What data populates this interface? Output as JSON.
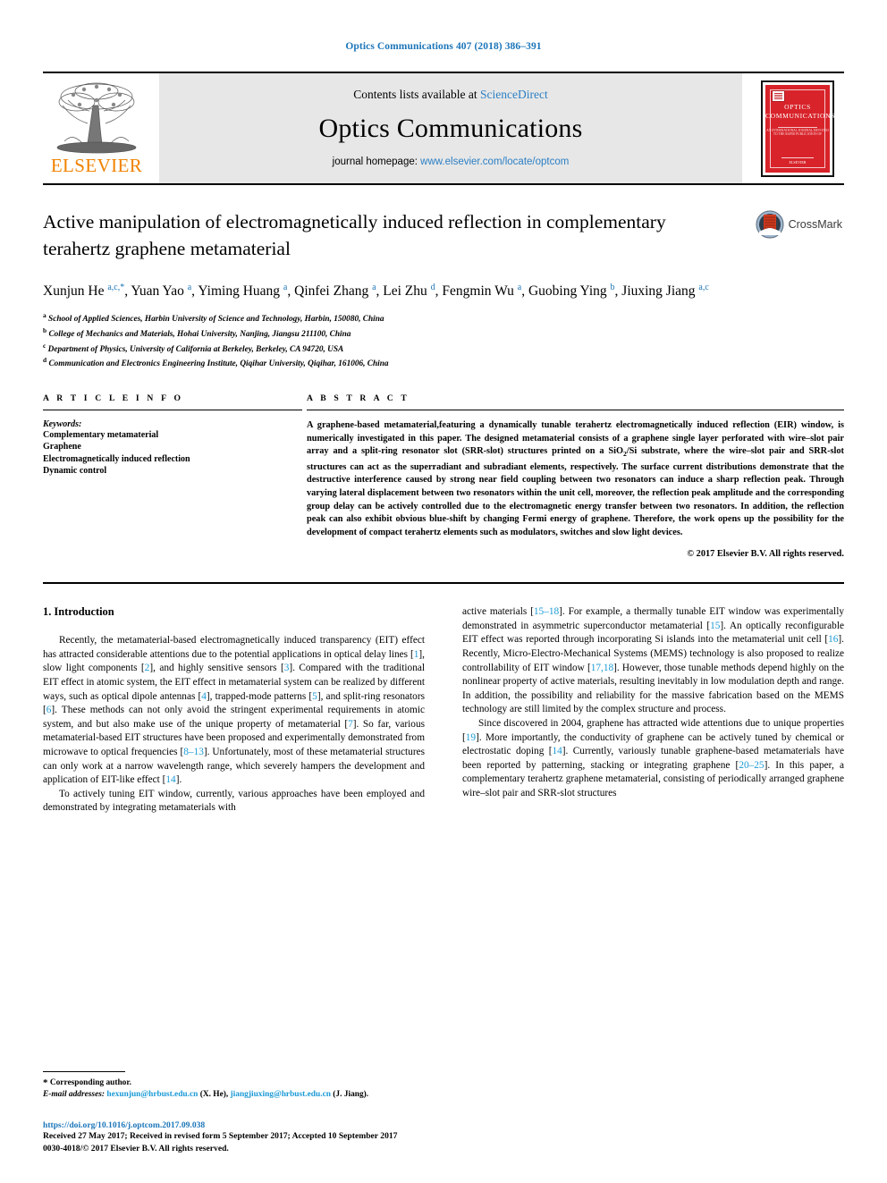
{
  "running_head": "Optics Communications 407 (2018) 386–391",
  "masthead": {
    "contents_prefix": "Contents lists available at ",
    "contents_link": "ScienceDirect",
    "journal_title": "Optics Communications",
    "homepage_prefix": "journal homepage: ",
    "homepage_link": "www.elsevier.com/locate/optcom",
    "publisher_wordmark": "ELSEVIER",
    "cover": {
      "title_line1": "OPTICS",
      "title_line2": "COMMUNICATIONS",
      "subtitle": "AN INTERNATIONAL JOURNAL\nDEVOTED TO THE RAPID PUBLICATION OF",
      "footer_line": "ELSEVIER"
    }
  },
  "article": {
    "title": "Active manipulation of electromagnetically induced reflection in complementary terahertz graphene metamaterial",
    "crossmark_label": "CrossMark",
    "authors_html": "Xunjun He <sup>a,c,</sup><sup class=\"star\">*</sup>, Yuan Yao <sup>a</sup>, Yiming Huang <sup>a</sup>, Qinfei Zhang <sup>a</sup>, Lei Zhu <sup>d</sup>, Fengmin Wu <sup>a</sup>, Guobing Ying <sup>b</sup>, Jiuxing Jiang <sup>a,c</sup>",
    "affiliations": [
      {
        "mark": "a",
        "text": "School of Applied Sciences, Harbin University of Science and Technology, Harbin, 150080, China"
      },
      {
        "mark": "b",
        "text": "College of Mechanics and Materials, Hohai University, Nanjing, Jiangsu 211100, China"
      },
      {
        "mark": "c",
        "text": "Department of Physics, University of California at Berkeley, Berkeley, CA 94720, USA"
      },
      {
        "mark": "d",
        "text": "Communication and Electronics Engineering Institute, Qiqihar University, Qiqihar, 161006, China"
      }
    ]
  },
  "article_info": {
    "heading": "A R T I C L E   I N F O",
    "keywords_label": "Keywords:",
    "keywords": [
      "Complementary metamaterial",
      "Graphene",
      "Electromagnetically induced reflection",
      "Dynamic control"
    ]
  },
  "abstract": {
    "heading": "A B S T R A C T",
    "text_html": "A graphene-based metamaterial,featuring a dynamically tunable terahertz electromagnetically induced reflection (EIR) window, is numerically investigated in this paper. The designed metamaterial consists of a graphene single layer perforated with wire–slot pair array and a split-ring resonator slot (SRR-slot) structures printed on a SiO<sub>2</sub>/Si substrate, where the wire–slot pair and SRR-slot structures can act as the superradiant and subradiant elements, respectively. The surface current distributions demonstrate that the destructive interference caused by strong near field coupling between two resonators can induce a sharp reflection peak. Through varying lateral displacement between two resonators within the unit cell, moreover, the reflection peak amplitude and the corresponding group delay can be actively controlled due to the electromagnetic energy transfer between two resonators. In addition, the reflection peak can also exhibit obvious blue-shift by changing Fermi energy of graphene. Therefore, the work opens up the possibility for the development of compact terahertz elements such as modulators, switches and slow light devices.",
    "copyright": "© 2017 Elsevier B.V. All rights reserved."
  },
  "body": {
    "section_title": "1.  Introduction",
    "left_paragraphs_html": [
      "Recently, the metamaterial-based electromagnetically induced transparency (EIT) effect has attracted considerable attentions due to the potential applications in optical delay lines [<span class=\"cite\">1</span>], slow light components [<span class=\"cite\">2</span>], and highly sensitive sensors [<span class=\"cite\">3</span>]. Compared with the traditional EIT effect in atomic system, the EIT effect in metamaterial system can be realized by different ways, such as optical dipole antennas [<span class=\"cite\">4</span>], trapped-mode patterns [<span class=\"cite\">5</span>], and split-ring resonators [<span class=\"cite\">6</span>]. These methods can not only avoid the stringent experimental requirements in atomic system, and but also make use of the unique property of metamaterial [<span class=\"cite\">7</span>]. So far, various metamaterial-based EIT structures have been proposed and experimentally demonstrated from microwave to optical frequencies [<span class=\"cite\">8–13</span>]. Unfortunately, most of these metamaterial structures can only work at a narrow wavelength range, which severely hampers the development and application of EIT-like effect [<span class=\"cite\">14</span>].",
      "To actively tuning EIT window, currently, various approaches have been employed and demonstrated by integrating metamaterials with"
    ],
    "right_paragraphs_html": [
      "active materials [<span class=\"cite\">15–18</span>]. For example, a thermally tunable EIT window was experimentally demonstrated in asymmetric superconductor metamaterial [<span class=\"cite\">15</span>]. An optically reconfigurable EIT effect was reported through incorporating Si islands into the metamaterial unit cell [<span class=\"cite\">16</span>]. Recently, Micro-Electro-Mechanical Systems (MEMS) technology is also proposed to realize controllability of EIT window [<span class=\"cite\">17,18</span>]. However, those tunable methods depend highly on the nonlinear property of active materials, resulting inevitably in low modulation depth and range. In addition, the possibility and reliability for the massive fabrication based on the MEMS technology are still limited by the complex structure and process.",
      "Since discovered in 2004, graphene has attracted wide attentions due to unique properties [<span class=\"cite\">19</span>]. More importantly, the conductivity of graphene can be actively tuned by chemical or electrostatic doping [<span class=\"cite\">14</span>]. Currently, variously tunable graphene-based metamaterials have been reported by patterning, stacking or integrating graphene [<span class=\"cite\">20–25</span>]. In this paper, a complementary terahertz graphene metamaterial, consisting of periodically arranged graphene wire–slot pair and SRR-slot structures"
    ]
  },
  "footnotes": {
    "corresponding_marker": "*",
    "corresponding_text": "Corresponding author.",
    "email_label": "E-mail addresses:",
    "emails_html": "<a>hexunjun@hrbust.edu.cn</a> (X. He), <a>jiangjiuxing@hrbust.edu.cn</a> (J. Jiang)."
  },
  "colophon": {
    "doi": "https://doi.org/10.1016/j.optcom.2017.09.038",
    "dates": "Received 27 May 2017; Received in revised form 5 September 2017; Accepted 10 September 2017",
    "rights": "0030-4018/© 2017 Elsevier B.V. All rights reserved."
  },
  "colors": {
    "link_blue": "#2b7fc4",
    "cite_blue": "#1b9ad6",
    "elsevier_orange": "#f08200",
    "cover_red": "#d8232a"
  }
}
